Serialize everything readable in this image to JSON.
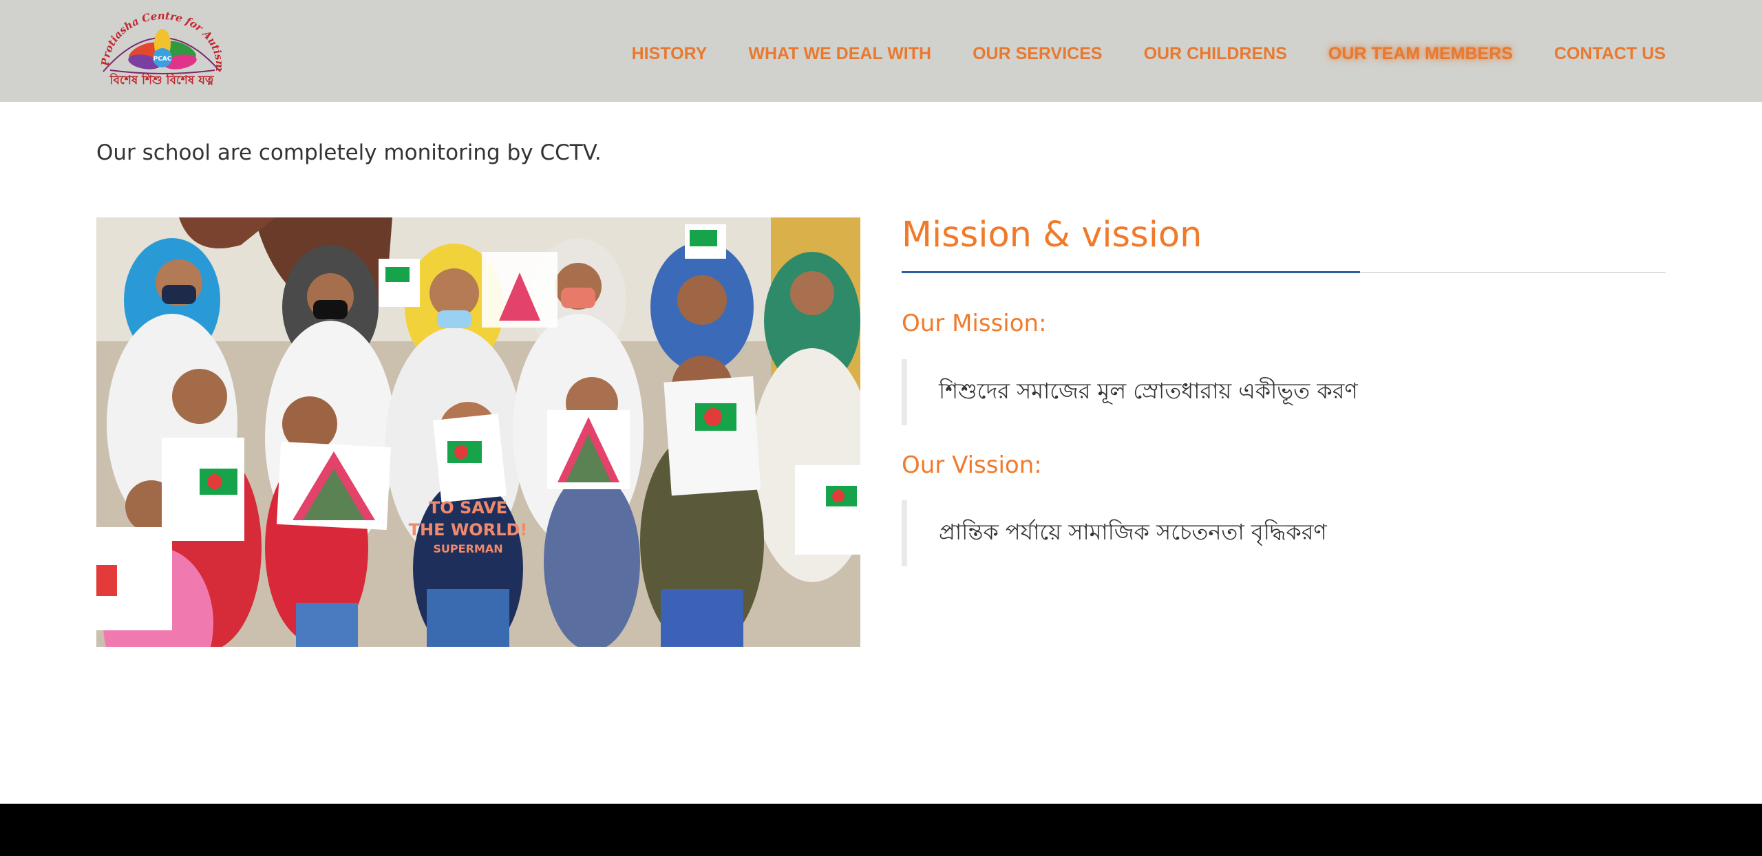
{
  "logo": {
    "arc_text": "Protiasha Centre for Autism Care",
    "badge_text": "PCAC",
    "tagline": "বিশেষ শিশু বিশেষ যত্ন"
  },
  "nav": {
    "items": [
      {
        "label": "HISTORY"
      },
      {
        "label": "WHAT WE DEAL WITH"
      },
      {
        "label": "OUR SERVICES"
      },
      {
        "label": "OUR CHILDRENS"
      },
      {
        "label": "OUR TEAM MEMBERS"
      },
      {
        "label": "CONTACT US"
      }
    ],
    "active_index": 4
  },
  "content": {
    "cut_line": "... ,",
    "intro": "Our school are completely monitoring by CCTV.",
    "mission_vission_title": "Mission & vission",
    "mission": {
      "heading": "Our Mission:",
      "text": "শিশুদের সমাজের মূল স্রোতধারায় একীভূত করণ"
    },
    "vission": {
      "heading": "Our Vission:",
      "text": "প্রান্তিক পর্যায়ে সামাজিক সচেতনতা বৃদ্ধিকরণ"
    }
  },
  "photo": {
    "shirt_text_line1": "TO SAVE",
    "shirt_text_line2": "THE WORLD!",
    "shirt_text_line3": "SUPERMAN"
  },
  "colors": {
    "header_bg": "#d1d2ce",
    "accent_orange": "#f07a2a",
    "rule_blue": "#2b5f9e",
    "footer_bg": "#000000"
  }
}
